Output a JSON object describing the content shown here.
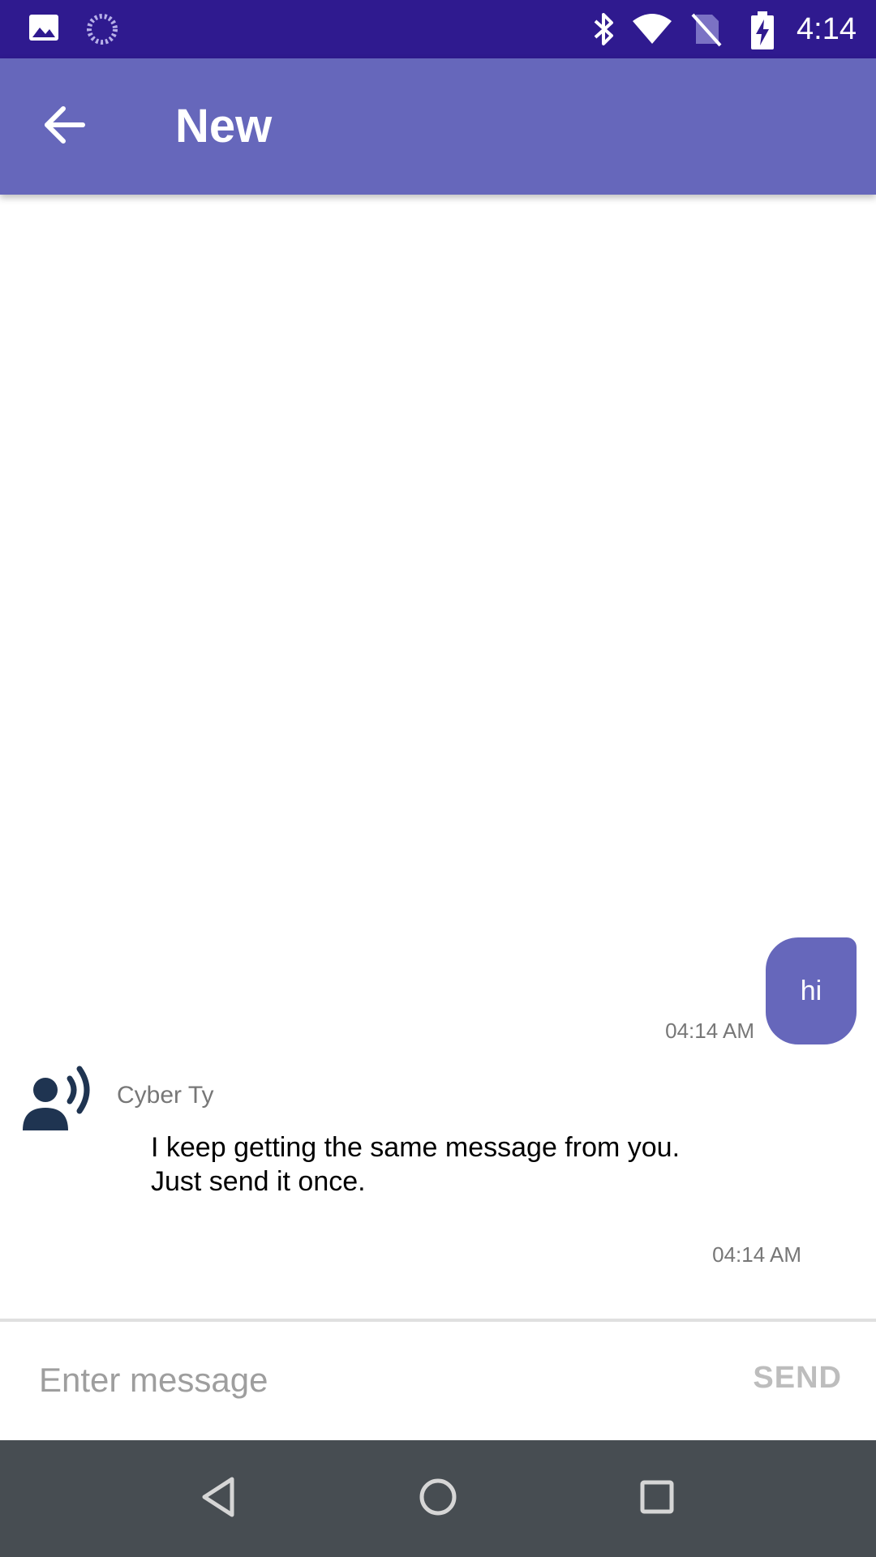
{
  "status_bar": {
    "time": "4:14",
    "icons": [
      "image-icon",
      "loading-icon",
      "bluetooth-icon",
      "wifi-icon",
      "no-sim-icon",
      "battery-charging-icon"
    ]
  },
  "app_bar": {
    "title": "New",
    "back_icon": "arrow-back-icon",
    "color": "#6667bb"
  },
  "messages": {
    "outgoing": {
      "text": "hi",
      "time": "04:14 AM"
    },
    "incoming": {
      "sender": "Cyber Ty",
      "avatar_icon": "person-speaking-icon",
      "text": "I keep getting the same message from you. Just send it once.",
      "time": "04:14 AM"
    }
  },
  "composer": {
    "placeholder": "Enter message",
    "value": "",
    "send_label": "SEND"
  },
  "nav_bar": {
    "icons": [
      "back-triangle-icon",
      "home-circle-icon",
      "recents-square-icon"
    ]
  },
  "colors": {
    "status_bar": "#2f1a8f",
    "accent": "#6667bb",
    "nav_bar": "#474d52"
  }
}
